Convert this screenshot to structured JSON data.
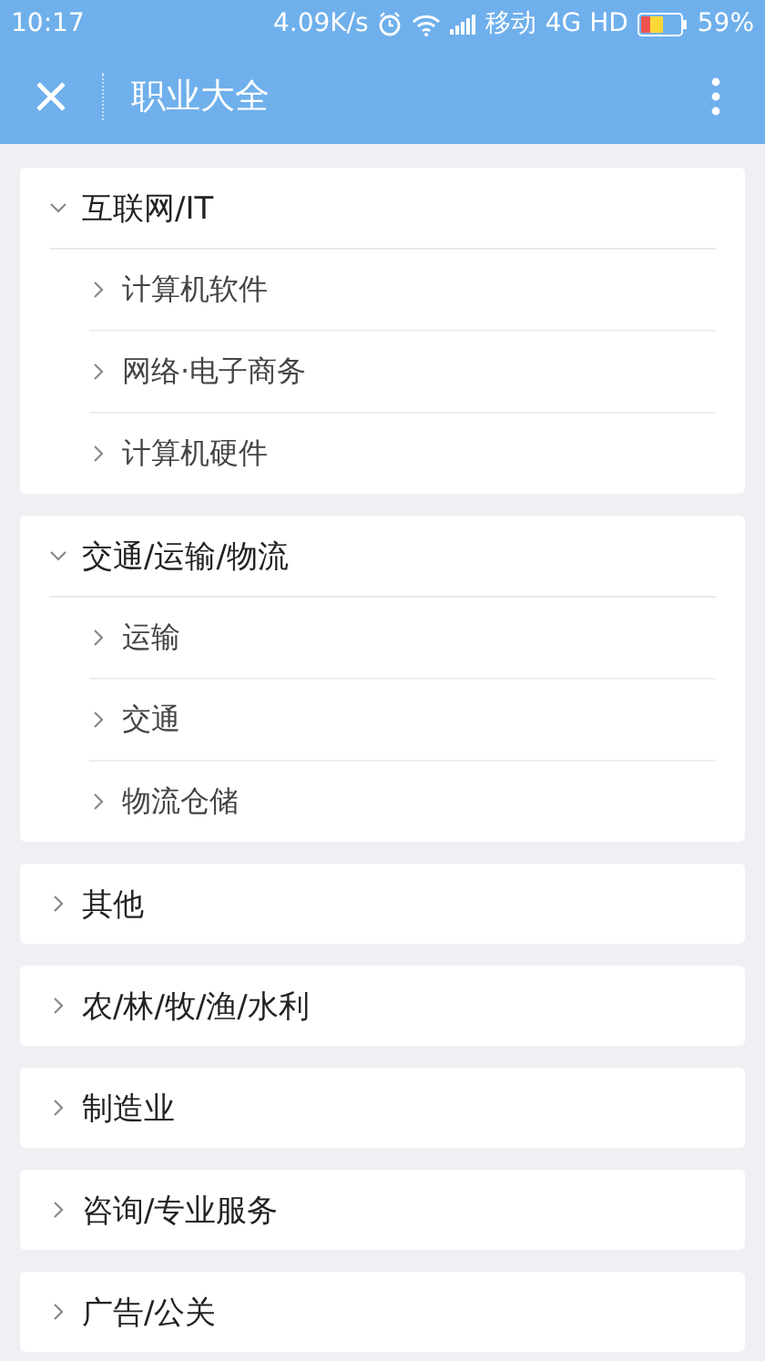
{
  "status_bar": {
    "time": "10:17",
    "speed": "4.09K/s",
    "carrier": "移动",
    "network": "4G HD",
    "battery": "59%"
  },
  "header": {
    "title": "职业大全"
  },
  "categories": [
    {
      "label": "互联网/IT",
      "expanded": true,
      "children": [
        {
          "label": "计算机软件",
          "expanded": false
        },
        {
          "label": "网络·电子商务",
          "expanded": false
        },
        {
          "label": "计算机硬件",
          "expanded": false
        }
      ]
    },
    {
      "label": "交通/运输/物流",
      "expanded": true,
      "children": [
        {
          "label": "运输",
          "expanded": false
        },
        {
          "label": "交通",
          "expanded": false
        },
        {
          "label": "物流仓储",
          "expanded": false
        }
      ]
    },
    {
      "label": "其他",
      "expanded": false
    },
    {
      "label": "农/林/牧/渔/水利",
      "expanded": false
    },
    {
      "label": "制造业",
      "expanded": false
    },
    {
      "label": "咨询/专业服务",
      "expanded": false
    },
    {
      "label": "广告/公关",
      "expanded": false
    }
  ]
}
